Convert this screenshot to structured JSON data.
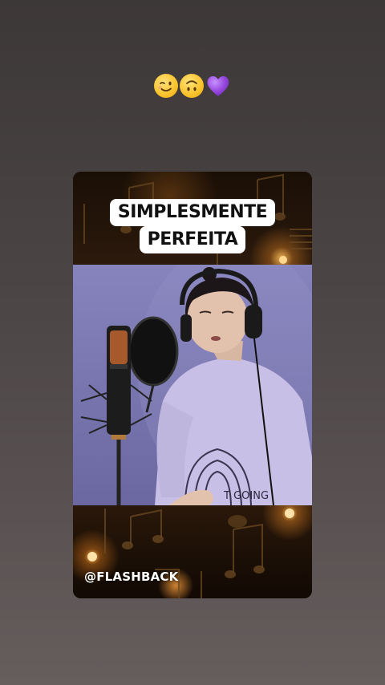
{
  "story": {
    "emoji_reaction": [
      "winking-face",
      "upside-down-face",
      "purple-heart"
    ],
    "caption": {
      "line1": "SIMPLESMENTE",
      "line2": "PERFEITA"
    },
    "credit": "@FLASHBACK",
    "sweater_text": "T GOING",
    "colors": {
      "background_top": "#3d3838",
      "background_bottom": "#665e5d",
      "video_backdrop": "#7f7bb7",
      "caption_bg": "#ffffff",
      "caption_text": "#111111",
      "heart": "#9b4de0"
    }
  }
}
